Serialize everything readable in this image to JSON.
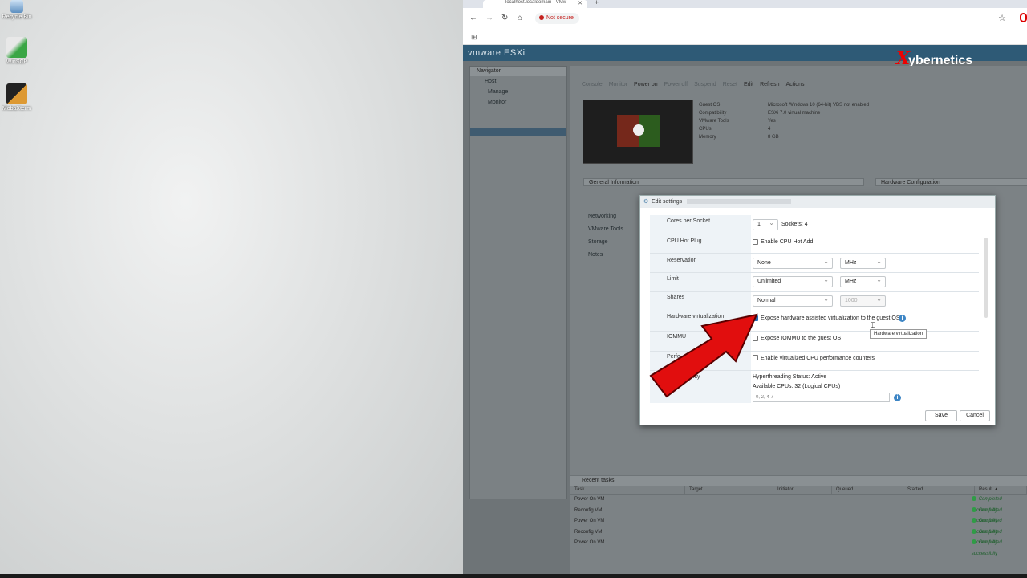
{
  "desktop": {
    "icons": [
      {
        "label": "Recycle Bin",
        "icon": "recycle-bin-icon"
      },
      {
        "label": "WinSCP",
        "icon": "winscp-icon"
      },
      {
        "label": "MobaXterm",
        "icon": "mobaxterm-icon"
      }
    ]
  },
  "browser": {
    "tab_title": "localhost.localdomain - VMw",
    "tab_close": "✕",
    "new_tab": "+",
    "security_label": "Not secure",
    "back_glyph": "←",
    "forward_glyph": "→",
    "reload_glyph": "↻",
    "home_glyph": "⌂",
    "star_glyph": "☆",
    "apps_glyph": "⊞"
  },
  "esxi": {
    "logo": "vmware ESXi",
    "watermark_x": "X",
    "watermark_text": "ybernetics",
    "navigator": {
      "title": "Navigator",
      "items": [
        "Host",
        "Manage",
        "Monitor"
      ]
    },
    "toolbar": {
      "console": "Console",
      "monitor": "Monitor",
      "power_on": "Power on",
      "power_off": "Power off",
      "suspend": "Suspend",
      "reset": "Reset",
      "edit": "Edit",
      "refresh": "Refresh",
      "actions": "Actions"
    },
    "vm_props": {
      "labels": [
        "Guest OS",
        "Compatibility",
        "VMware Tools",
        "CPUs",
        "Memory"
      ],
      "values": [
        "Microsoft Windows 10 (64-bit) VBS not enabled",
        "ESXi 7.0 virtual machine",
        "Yes",
        "4",
        "8 GB"
      ]
    },
    "general_info": {
      "title": "General Information",
      "items": [
        "Networking",
        "VMware Tools",
        "Storage",
        "Notes"
      ]
    },
    "hardware_config": {
      "title": "Hardware Configuration"
    },
    "recent_tasks": {
      "title": "Recent tasks",
      "columns": [
        "Task",
        "Target",
        "Initiator",
        "Queued",
        "Started",
        "Result ▲"
      ],
      "rows": [
        {
          "task": "Power On VM",
          "result": "Completed successfully"
        },
        {
          "task": "Reconfig VM",
          "result": "Completed successfully"
        },
        {
          "task": "Power On VM",
          "result": "Completed successfully"
        },
        {
          "task": "Reconfig VM",
          "result": "Completed successfully"
        },
        {
          "task": "Power On VM",
          "result": "Completed successfully"
        }
      ]
    }
  },
  "dialog": {
    "title": "Edit settings",
    "cores_per_socket": {
      "label": "Cores per Socket",
      "value": "1",
      "sockets_text": "Sockets: 4"
    },
    "cpu_hot_plug": {
      "label": "CPU Hot Plug",
      "checkbox_label": "Enable CPU Hot Add",
      "checked": false
    },
    "reservation": {
      "label": "Reservation",
      "value": "None",
      "unit": "MHz"
    },
    "limit": {
      "label": "Limit",
      "value": "Unlimited",
      "unit": "MHz"
    },
    "shares": {
      "label": "Shares",
      "value": "Normal",
      "amount": "1000"
    },
    "hardware_virtualization": {
      "label": "Hardware virtualization",
      "checkbox_label": "Expose hardware assisted virtualization to the guest OS",
      "checked": true,
      "tooltip": "Hardware virtualization"
    },
    "iommu": {
      "label": "IOMMU",
      "checkbox_label": "Expose IOMMU to the guest OS",
      "checked": false
    },
    "performance_counters": {
      "label": "Perfo",
      "checkbox_label": "Enable virtualized CPU performance counters",
      "checked": false
    },
    "scheduling_affinity": {
      "label": "inity",
      "hyperthreading": "Hyperthreading Status: Active",
      "available_cpus": "Available CPUs: 32 (Logical CPUs)",
      "placeholder": "0, 2, 4-7"
    },
    "save_label": "Save",
    "cancel_label": "Cancel",
    "info_glyph": "i"
  },
  "colors": {
    "esxi_header": "#2e5a76",
    "arrow": "#e10e0e",
    "checkbox_checked": "#2a6fb3",
    "not_secure": "#c5221f"
  }
}
